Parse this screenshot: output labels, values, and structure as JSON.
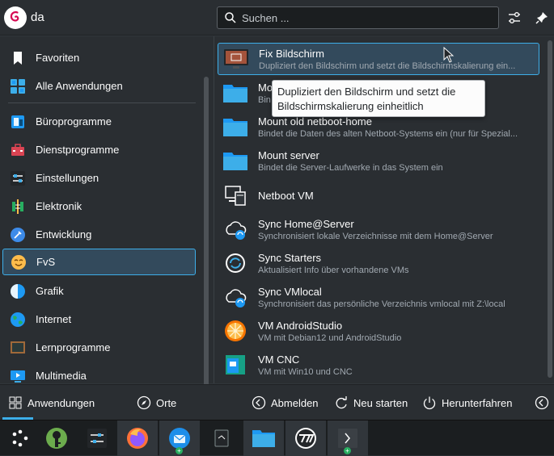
{
  "header": {
    "username": "da",
    "search_placeholder": "Suchen ..."
  },
  "sidebar": {
    "items": [
      {
        "label": "Favoriten",
        "icon": "bookmark-icon"
      },
      {
        "label": "Alle Anwendungen",
        "icon": "grid-icon"
      },
      {
        "label": "Büroprogramme",
        "icon": "office-icon"
      },
      {
        "label": "Dienstprogramme",
        "icon": "toolbox-icon"
      },
      {
        "label": "Einstellungen",
        "icon": "settings-sliders-icon"
      },
      {
        "label": "Elektronik",
        "icon": "electronics-icon"
      },
      {
        "label": "Entwicklung",
        "icon": "development-icon"
      },
      {
        "label": "FvS",
        "icon": "smiley-icon"
      },
      {
        "label": "Grafik",
        "icon": "graphics-icon"
      },
      {
        "label": "Internet",
        "icon": "globe-icon"
      },
      {
        "label": "Lernprogramme",
        "icon": "blackboard-icon"
      },
      {
        "label": "Multimedia",
        "icon": "multimedia-icon"
      }
    ]
  },
  "apps": [
    {
      "title": "Fix Bildschirm",
      "desc": "Dupliziert den Bildschirm und setzt die Bildschirmskalierung ein...",
      "icon": "display-icon"
    },
    {
      "title": "Mo",
      "desc": "Bin",
      "icon": "folder-icon"
    },
    {
      "title": "Mount old netboot-home",
      "desc": "Bindet die Daten des alten Netboot-Systems ein (nur für Spezial...",
      "icon": "folder-icon"
    },
    {
      "title": "Mount server",
      "desc": "Bindet die Server-Laufwerke in das System ein",
      "icon": "folder-icon"
    },
    {
      "title": "Netboot VM",
      "desc": "",
      "icon": "network-computer-icon"
    },
    {
      "title": "Sync Home@Server",
      "desc": "Synchronisiert lokale Verzeichnisse mit dem Home@Server",
      "icon": "cloud-sync-icon"
    },
    {
      "title": "Sync Starters",
      "desc": "Aktualisiert Info über vorhandene VMs",
      "icon": "sync-icon"
    },
    {
      "title": "Sync VMlocal",
      "desc": "Synchronisiert das persönliche Verzeichnis vmlocal mit Z:\\local",
      "icon": "cloud-sync-icon"
    },
    {
      "title": "VM AndroidStudio",
      "desc": "VM mit Debian12 und AndroidStudio",
      "icon": "orange-slice-icon"
    },
    {
      "title": "VM CNC",
      "desc": "VM mit Win10 und CNC",
      "icon": "cnc-icon"
    }
  ],
  "tooltip": {
    "line1": "Dupliziert den Bildschirm und setzt die",
    "line2": "Bildschirmskalierung einheitlich"
  },
  "footer": {
    "tab_apps": "Anwendungen",
    "tab_places": "Orte",
    "logout": "Abmelden",
    "restart": "Neu starten",
    "shutdown": "Herunterfahren"
  },
  "taskbar": {
    "items": [
      {
        "icon": "app-launcher-icon"
      },
      {
        "icon": "keepassxc-icon"
      },
      {
        "icon": "settings-icon"
      },
      {
        "icon": "firefox-icon"
      },
      {
        "icon": "thunderbird-icon"
      },
      {
        "icon": "document-icon"
      },
      {
        "icon": "folder-icon"
      },
      {
        "icon": "typora-icon"
      },
      {
        "icon": "terminal-icon"
      }
    ]
  },
  "colors": {
    "accent": "#3daee9",
    "background": "#2a2e32",
    "text": "#fcfcfc",
    "muted_text": "#a1a9b1"
  }
}
